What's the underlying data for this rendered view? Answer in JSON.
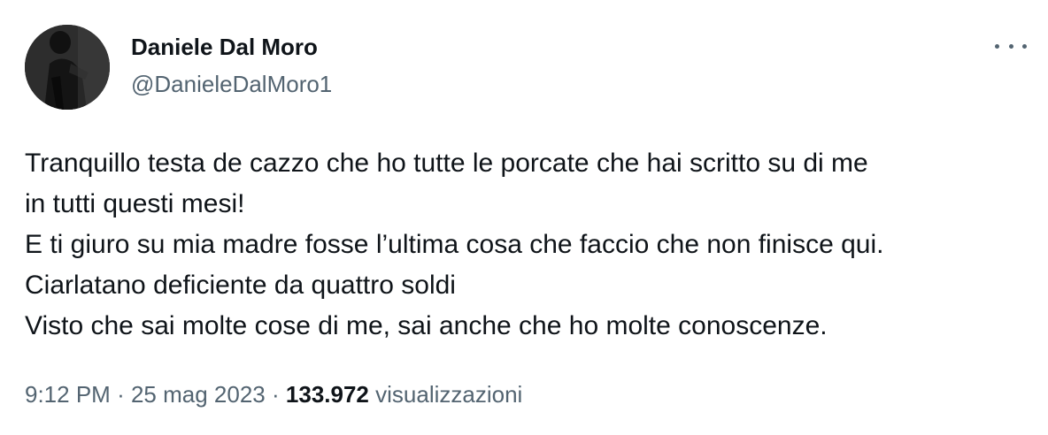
{
  "author": {
    "display_name": "Daniele Dal Moro",
    "handle": "@DanieleDalMoro1",
    "avatar_icon": "profile-photo"
  },
  "menu": {
    "more_icon": "more-horizontal-icon"
  },
  "tweet": {
    "lines": [
      "Tranquillo testa de cazzo che ho tutte le porcate che hai scritto su di me",
      "in tutti questi mesi!",
      "E ti giuro su mia madre fosse l’ultima cosa che faccio che non finisce qui.",
      "Ciarlatano deficiente da quattro soldi",
      "Visto che sai molte cose di me, sai anche che ho molte conoscenze."
    ]
  },
  "meta": {
    "time": "9:12 PM",
    "separator": "·",
    "date": "25 mag 2023",
    "views_count": "133.972",
    "views_label": "visualizzazioni"
  },
  "colors": {
    "text_primary": "#0f1419",
    "text_secondary": "#536471",
    "background": "#ffffff"
  }
}
